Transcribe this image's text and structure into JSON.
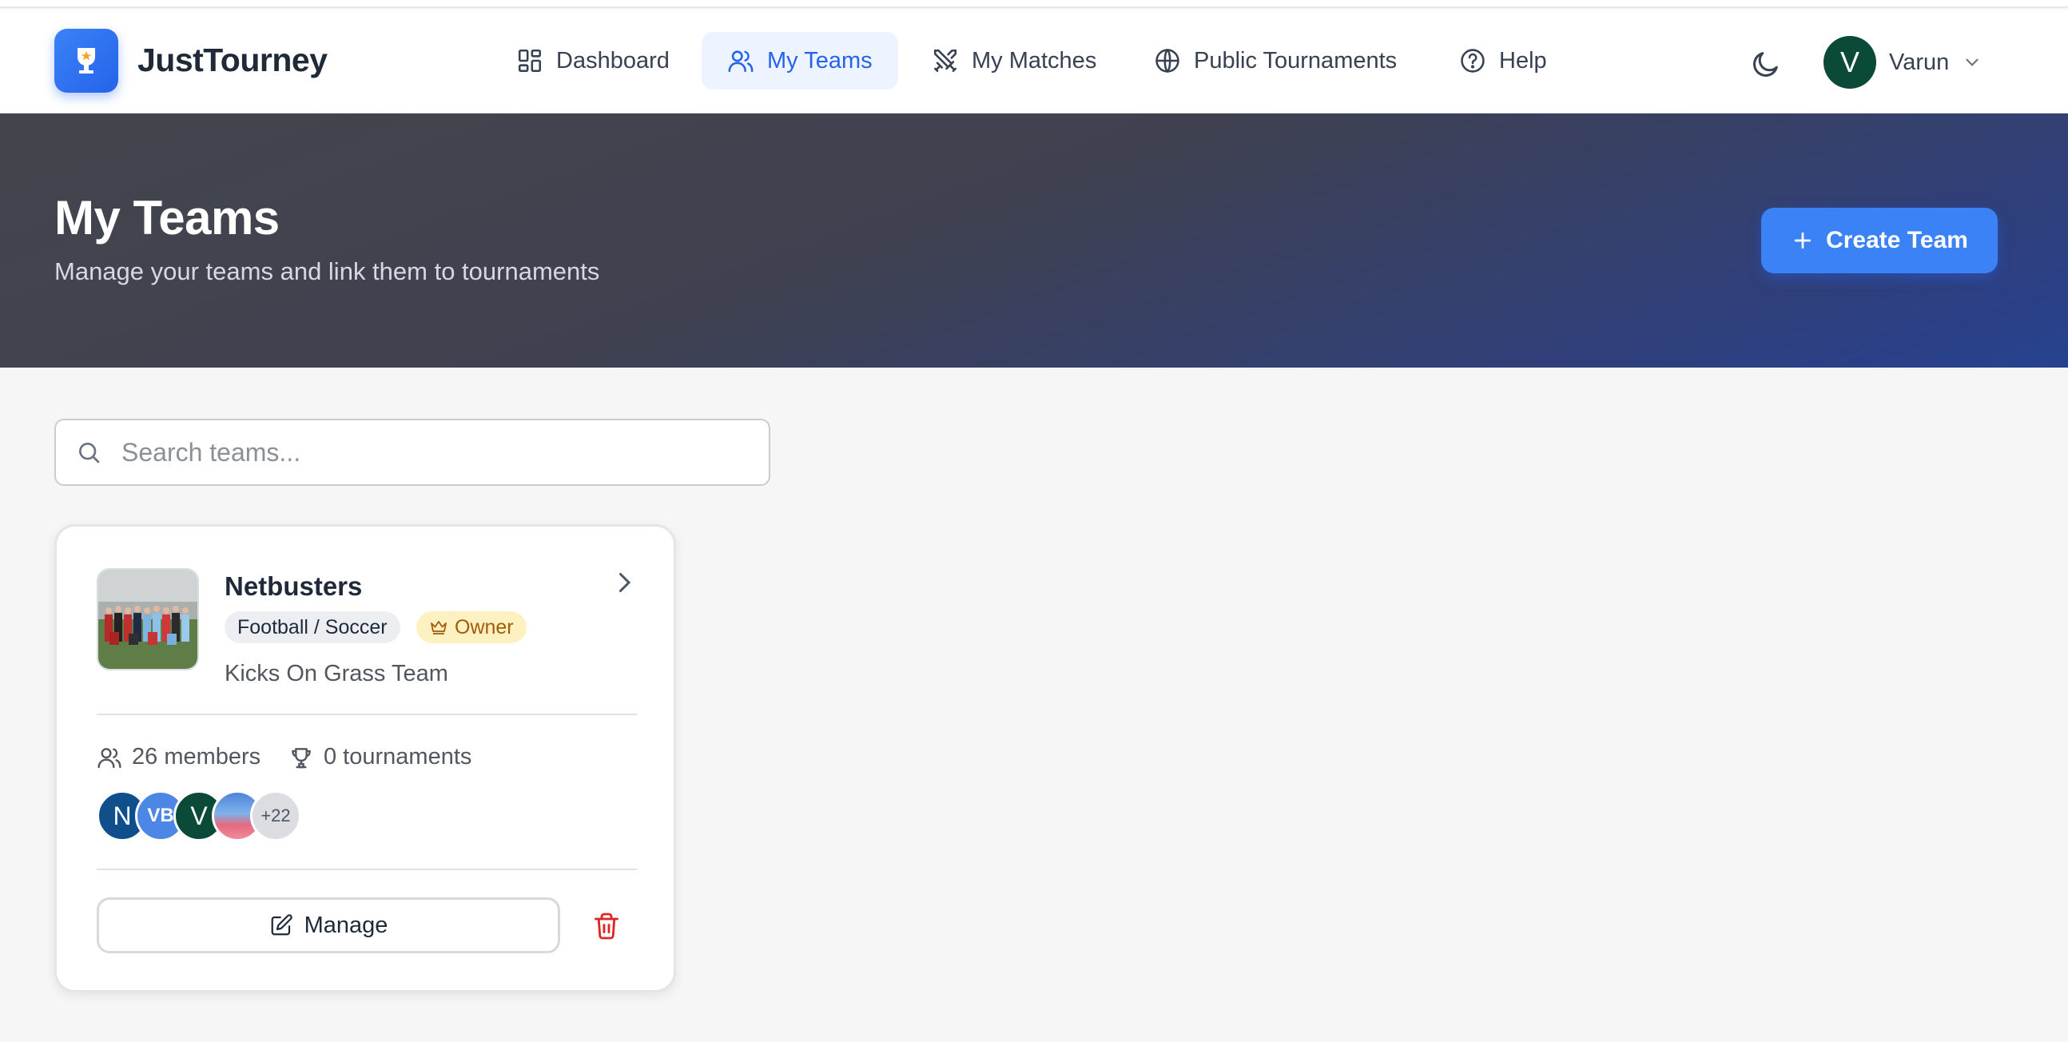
{
  "app": {
    "name": "JustTourney"
  },
  "nav": {
    "items": [
      {
        "label": "Dashboard",
        "icon": "dashboard-icon",
        "active": false
      },
      {
        "label": "My Teams",
        "icon": "users-icon",
        "active": true
      },
      {
        "label": "My Matches",
        "icon": "swords-icon",
        "active": false
      },
      {
        "label": "Public Tournaments",
        "icon": "globe-icon",
        "active": false
      },
      {
        "label": "Help",
        "icon": "help-circle-icon",
        "active": false
      }
    ]
  },
  "user": {
    "initial": "V",
    "name": "Varun"
  },
  "hero": {
    "title": "My Teams",
    "subtitle": "Manage your teams and link them to tournaments",
    "create_button": "Create Team"
  },
  "search": {
    "placeholder": "Search teams...",
    "value": ""
  },
  "teams": [
    {
      "name": "Netbusters",
      "sport": "Football / Soccer",
      "role": "Owner",
      "description": "Kicks On Grass Team",
      "members": "26 members",
      "tournaments": "0 tournaments",
      "avatars": [
        "N",
        "VB",
        "V"
      ],
      "more_count": "+22",
      "manage_label": "Manage"
    }
  ],
  "colors": {
    "accent": "#3b82f6",
    "owner_badge_bg": "#fdf1c2",
    "owner_badge_text": "#a15c07",
    "delete": "#dc2626"
  }
}
